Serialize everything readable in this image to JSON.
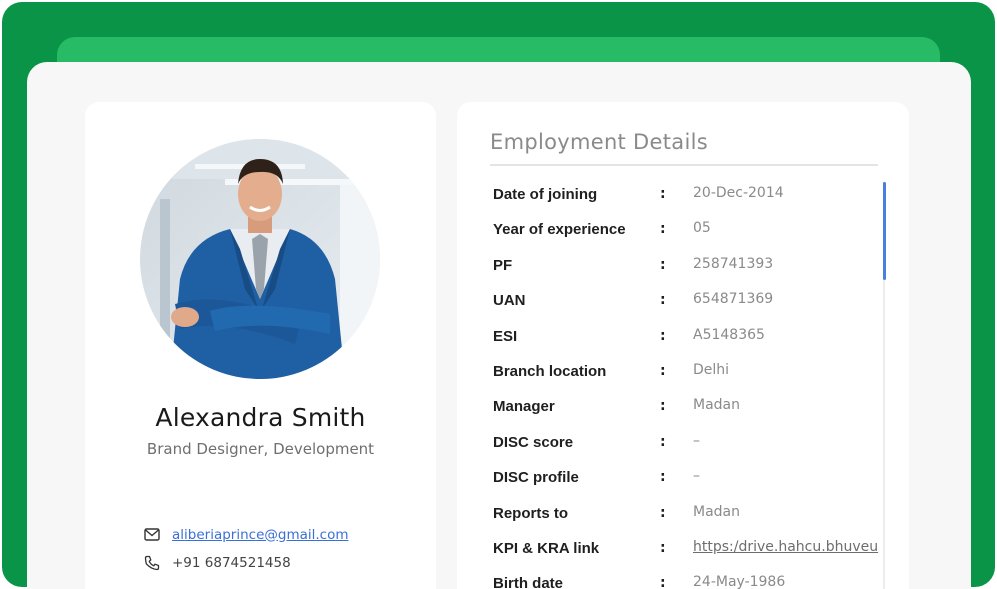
{
  "profile": {
    "name": "Alexandra Smith",
    "role": "Brand Designer, Development",
    "email": "aliberiaprince@gmail.com",
    "phone": "+91 6874521458",
    "icons": {
      "email": "mail-icon",
      "phone": "phone-icon"
    }
  },
  "employment": {
    "title": "Employment Details",
    "separator": ":",
    "rows": [
      {
        "label": "Date of joining",
        "value": "20-Dec-2014"
      },
      {
        "label": "Year of experience",
        "value": "05"
      },
      {
        "label": "PF",
        "value": "258741393"
      },
      {
        "label": "UAN",
        "value": "654871369"
      },
      {
        "label": "ESI",
        "value": "A5148365"
      },
      {
        "label": "Branch location",
        "value": "Delhi"
      },
      {
        "label": "Manager",
        "value": "Madan"
      },
      {
        "label": "DISC score",
        "value": "–"
      },
      {
        "label": "DISC profile",
        "value": "–"
      },
      {
        "label": "Reports to",
        "value": "Madan"
      },
      {
        "label": "KPI & KRA link",
        "value": "https:/drive.hahcu.bhuveu"
      },
      {
        "label": "Birth date",
        "value": "24-May-1986"
      }
    ]
  },
  "colors": {
    "outer": "#0a9447",
    "tab": "#27bb66",
    "accent_link": "#3a6fd8",
    "scroll_thumb": "#4a7fe0"
  }
}
